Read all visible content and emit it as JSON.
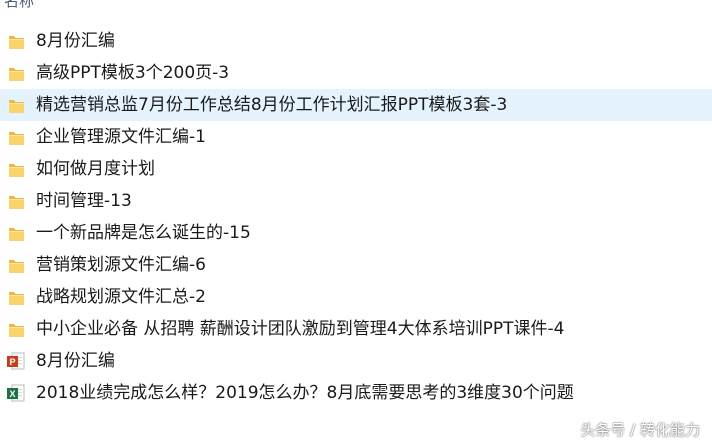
{
  "header": {
    "name_column": "名称"
  },
  "files": [
    {
      "name": "8月份汇编",
      "type": "folder",
      "selected": false
    },
    {
      "name": "高级PPT模板3个200页-3",
      "type": "folder",
      "selected": false
    },
    {
      "name": "精选营销总监7月份工作总结8月份工作计划汇报PPT模板3套-3",
      "type": "folder",
      "selected": true
    },
    {
      "name": "企业管理源文件汇编-1",
      "type": "folder",
      "selected": false
    },
    {
      "name": "如何做月度计划",
      "type": "folder",
      "selected": false
    },
    {
      "name": "时间管理-13",
      "type": "folder",
      "selected": false
    },
    {
      "name": "一个新品牌是怎么诞生的-15",
      "type": "folder",
      "selected": false
    },
    {
      "name": "营销策划源文件汇编-6",
      "type": "folder",
      "selected": false
    },
    {
      "name": "战略规划源文件汇总-2",
      "type": "folder",
      "selected": false
    },
    {
      "name": "中小企业必备 从招聘 薪酬设计团队激励到管理4大体系培训PPT课件-4",
      "type": "folder",
      "selected": false
    },
    {
      "name": "8月份汇编",
      "type": "ppt",
      "selected": false
    },
    {
      "name": "2018业绩完成怎么样？2019怎么办？8月底需要思考的3维度30个问题",
      "type": "excel",
      "selected": false
    }
  ],
  "watermark": "头条号 / 转化能力",
  "colors": {
    "folder": "#f8d56b",
    "folder_tab": "#e8b84a",
    "selection": "#e5f3ff",
    "ppt": "#c43e1c",
    "excel": "#1e7145"
  }
}
